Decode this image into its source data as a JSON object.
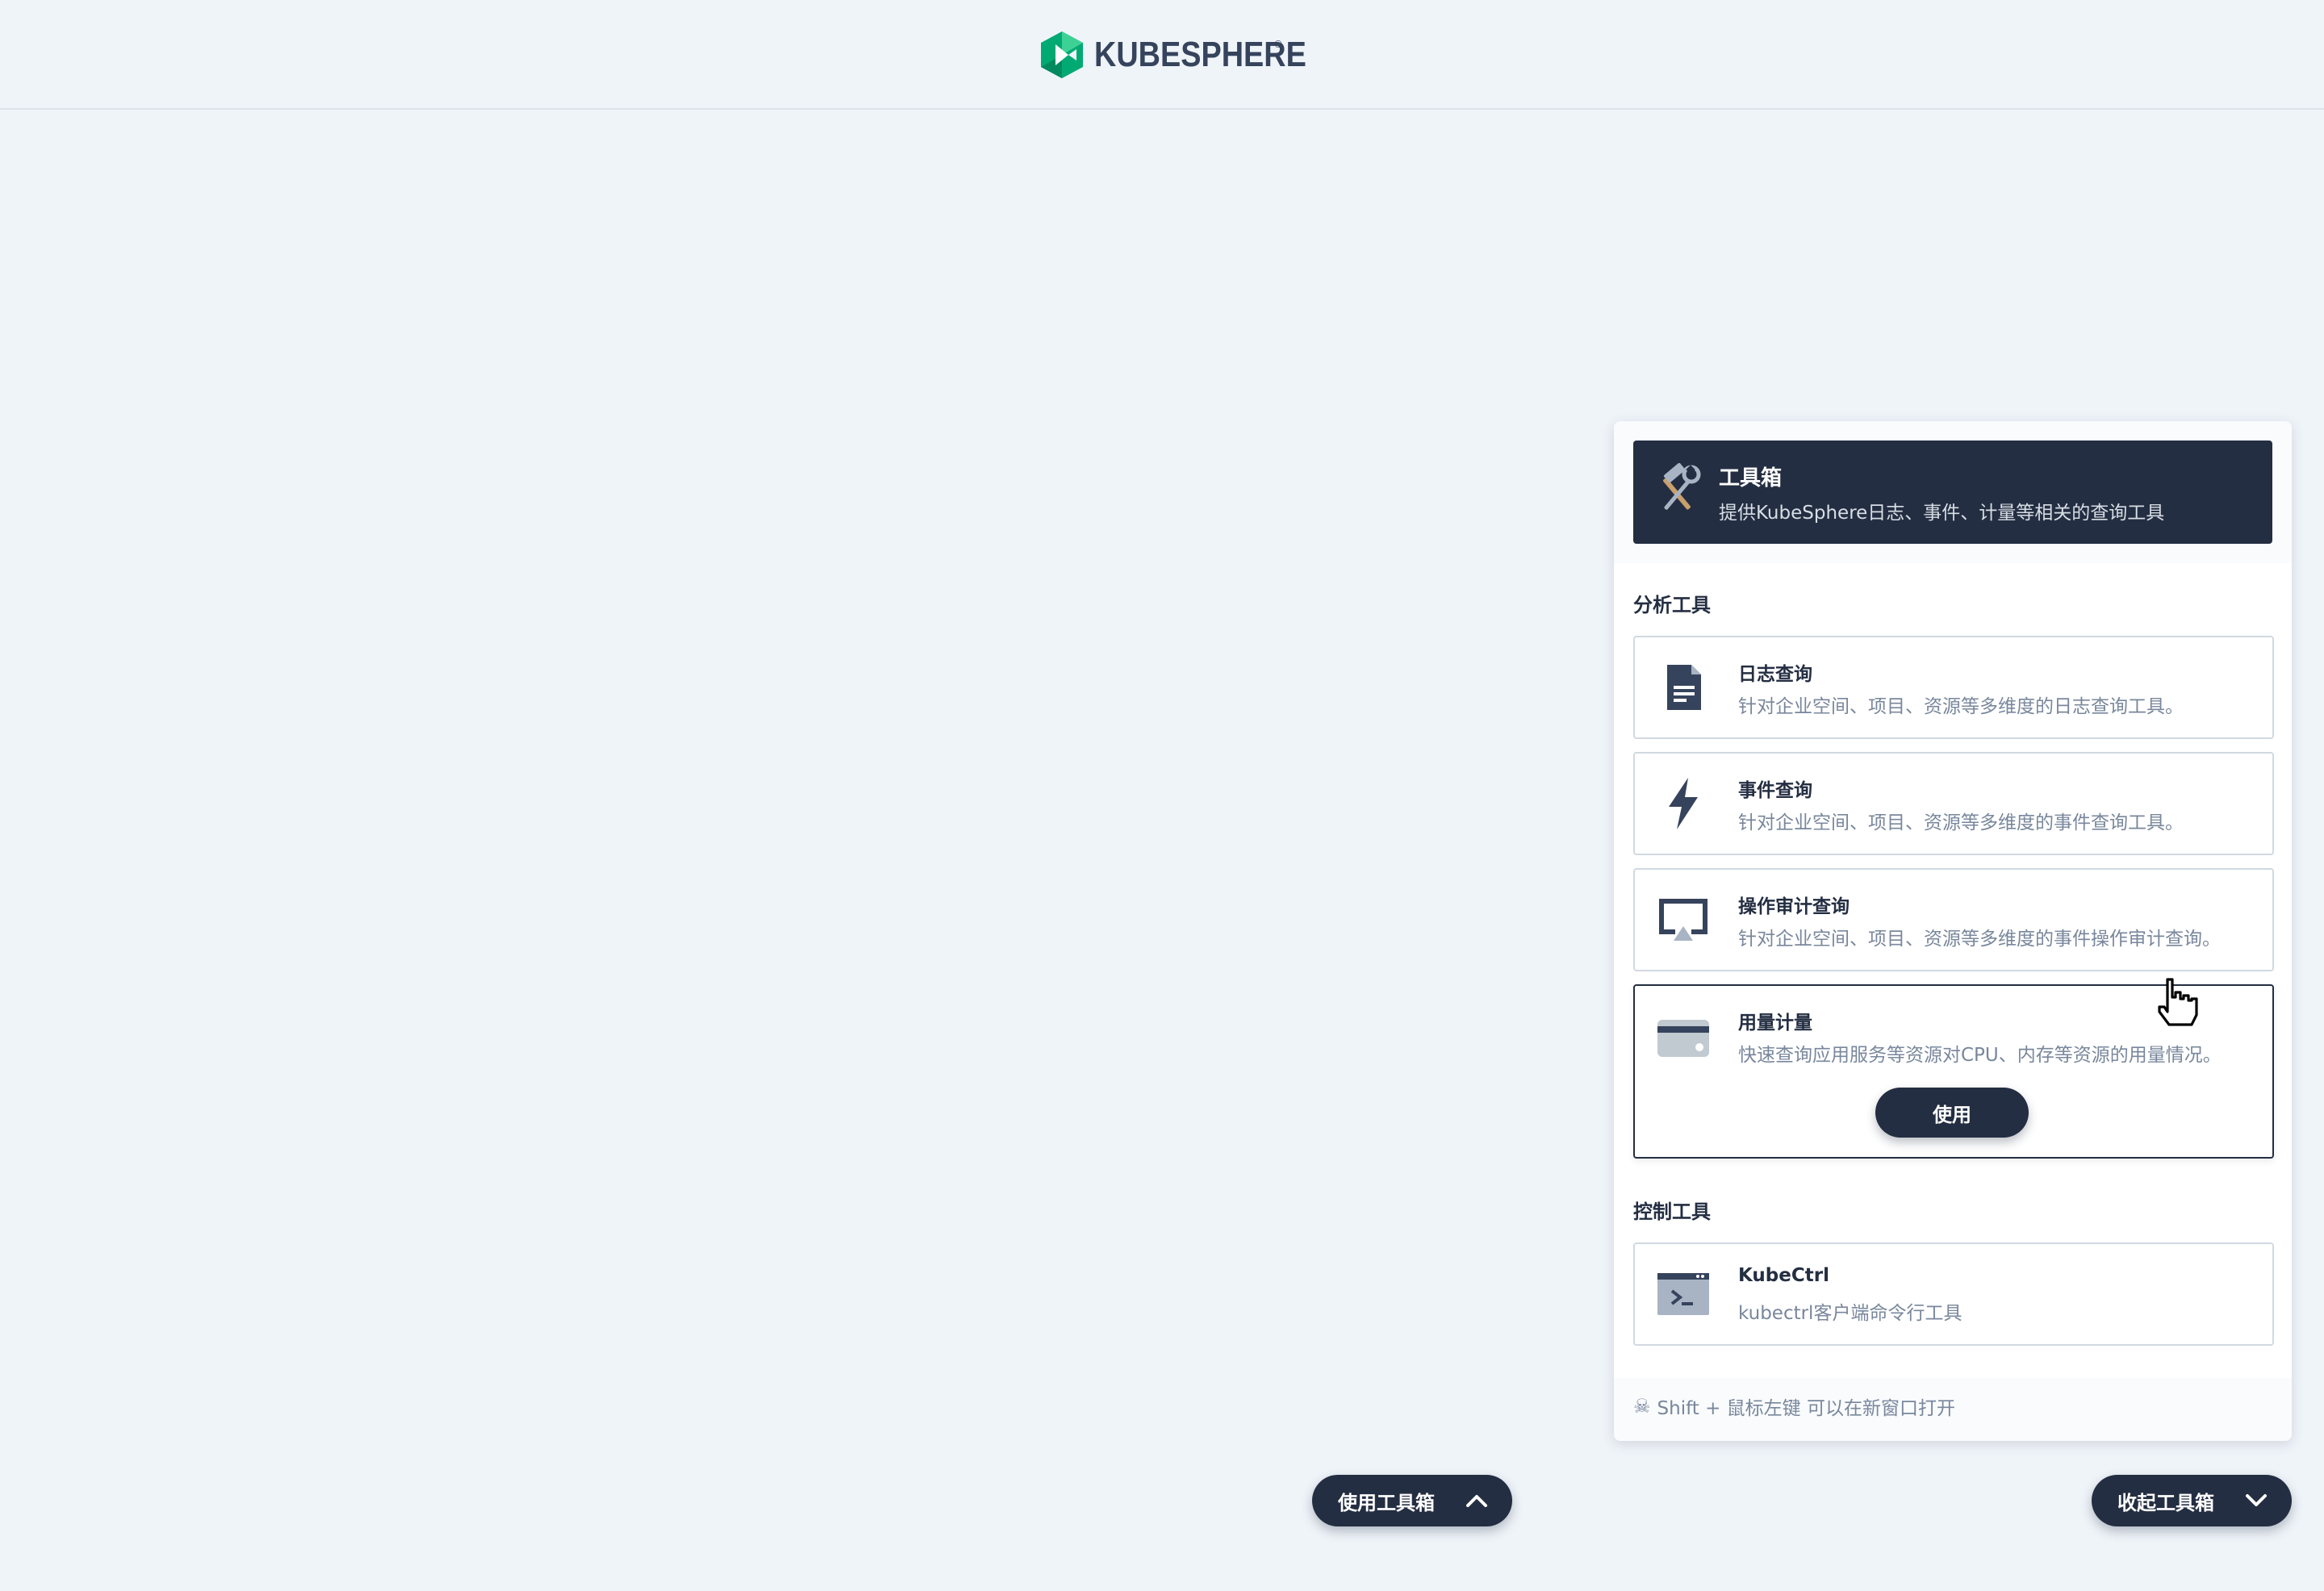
{
  "header": {
    "brand": "KUBESPHERE",
    "brand_mark": "®"
  },
  "toolbox": {
    "title": "工具箱",
    "description": "提供KubeSphere日志、事件、计量等相关的查询工具",
    "icon": "hammer-wrench-icon",
    "sections": {
      "analysis": {
        "title": "分析工具",
        "items": [
          {
            "title": "日志查询",
            "description": "针对企业空间、项目、资源等多维度的日志查询工具。",
            "icon": "document-icon"
          },
          {
            "title": "事件查询",
            "description": "针对企业空间、项目、资源等多维度的事件查询工具。",
            "icon": "lightning-icon"
          },
          {
            "title": "操作审计查询",
            "description": "针对企业空间、项目、资源等多维度的事件操作审计查询。",
            "icon": "monitor-icon"
          },
          {
            "title": "用量计量",
            "description": "快速查询应用服务等资源对CPU、内存等资源的用量情况。",
            "icon": "card-icon",
            "button": "使用"
          }
        ]
      },
      "control": {
        "title": "控制工具",
        "items": [
          {
            "title": "KubeCtrl",
            "description": "kubectrl客户端命令行工具",
            "icon": "terminal-icon"
          }
        ]
      }
    },
    "footer_tip": "Shift + 鼠标左键 可以在新窗口打开"
  },
  "buttons": {
    "open_toolbox": "使用工具箱",
    "collapse_toolbox": "收起工具箱"
  },
  "colors": {
    "background": "#eff4f9",
    "dark": "#242e42",
    "muted_text": "#79879c",
    "brand_green": "#00aa72"
  }
}
